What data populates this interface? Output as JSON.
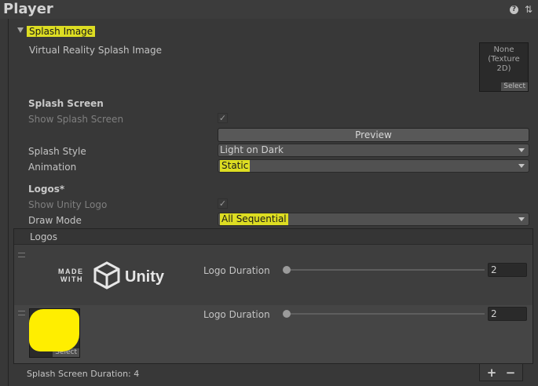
{
  "window": {
    "title": "Player"
  },
  "section": {
    "title": "Splash Image"
  },
  "vr_splash": {
    "label": "Virtual Reality Splash Image",
    "texture_none": "None",
    "texture_type": "(Texture 2D)",
    "select": "Select"
  },
  "splash_screen": {
    "heading": "Splash Screen",
    "show_label": "Show Splash Screen",
    "preview_button": "Preview",
    "style_label": "Splash Style",
    "style_value": "Light on Dark",
    "animation_label": "Animation",
    "animation_value": "Static"
  },
  "logos_section": {
    "heading": "Logos*",
    "show_unity_logo_label": "Show Unity Logo",
    "draw_mode_label": "Draw Mode",
    "draw_mode_value": "All Sequential"
  },
  "logos_list": {
    "title": "Logos",
    "items": [
      {
        "logo_made": "MADE",
        "logo_with": "WITH",
        "logo_name": "Unity",
        "duration_label": "Logo Duration",
        "duration_value": "2",
        "slider_fraction": 0.0
      },
      {
        "duration_label": "Logo Duration",
        "duration_value": "2",
        "select": "Select",
        "slider_fraction": 0.0
      }
    ]
  },
  "footer": {
    "duration_text": "Splash Screen Duration: 4",
    "add": "+",
    "remove": "−"
  },
  "colors": {
    "highlight": "#dddd22",
    "background": "#383838",
    "logo_fill": "#ffee00"
  },
  "icons": {
    "help": "help-icon",
    "settings": "settings-sliders-icon",
    "foldout": "triangle-down-icon",
    "handle": "drag-handle-icon",
    "check": "checkmark-icon",
    "dropdown": "chevron-down-icon"
  }
}
